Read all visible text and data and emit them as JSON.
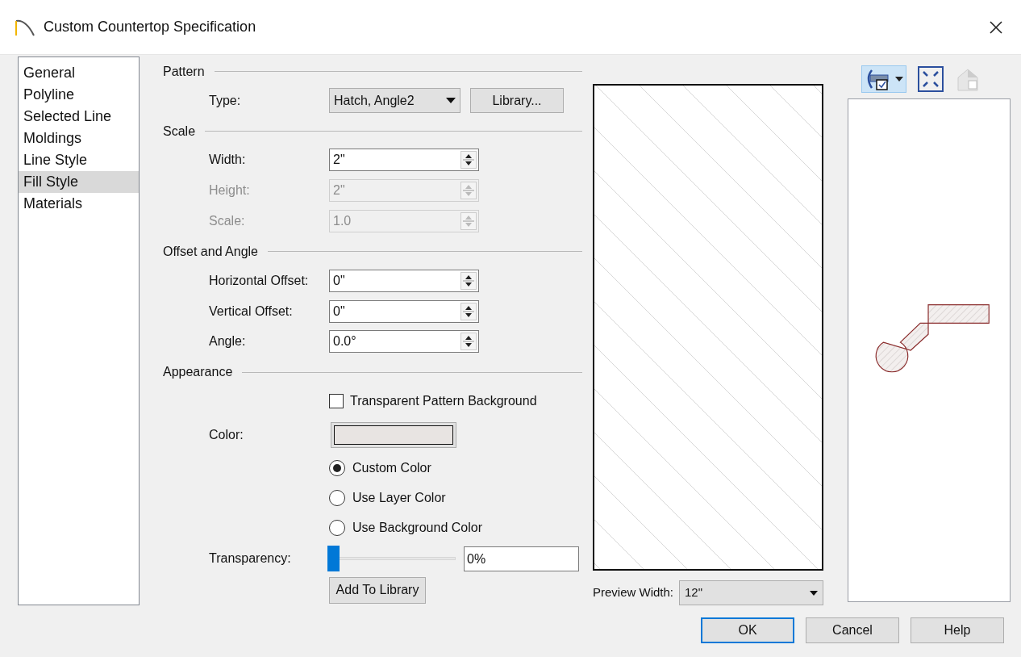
{
  "window": {
    "title": "Custom Countertop Specification"
  },
  "sidebar": {
    "items": [
      {
        "label": "General",
        "selected": false
      },
      {
        "label": "Polyline",
        "selected": false
      },
      {
        "label": "Selected Line",
        "selected": false
      },
      {
        "label": "Moldings",
        "selected": false
      },
      {
        "label": "Line Style",
        "selected": false
      },
      {
        "label": "Fill Style",
        "selected": true
      },
      {
        "label": "Materials",
        "selected": false
      }
    ]
  },
  "sections": [
    {
      "title": "Pattern",
      "rows": [
        {
          "kind": "dropdown",
          "label": "Type:",
          "value": "Hatch, Angle2",
          "button": "Library..."
        }
      ]
    },
    {
      "title": "Scale",
      "rows": [
        {
          "kind": "spin",
          "label": "Width:",
          "value": "2\"",
          "disabled": false
        },
        {
          "kind": "spin",
          "label": "Height:",
          "value": "2\"",
          "disabled": true
        },
        {
          "kind": "spin",
          "label": "Scale:",
          "value": "1.0",
          "disabled": true
        }
      ]
    },
    {
      "title": "Offset and Angle",
      "rows": [
        {
          "kind": "spin",
          "label": "Horizontal Offset:",
          "value": "0\"",
          "disabled": false
        },
        {
          "kind": "spin",
          "label": "Vertical Offset:",
          "value": "0\"",
          "disabled": false
        },
        {
          "kind": "spin",
          "label": "Angle:",
          "value": "0.0°",
          "disabled": false
        }
      ]
    },
    {
      "title": "Appearance",
      "rows": [
        {
          "kind": "checkbox",
          "label": "Transparent Pattern Background",
          "checked": false
        },
        {
          "kind": "color",
          "label": "Color:",
          "color": "#e8e4e2"
        },
        {
          "kind": "radio",
          "label": "Custom Color",
          "selected": true
        },
        {
          "kind": "radio",
          "label": "Use Layer Color",
          "selected": false
        },
        {
          "kind": "radio",
          "label": "Use Background Color",
          "selected": false
        },
        {
          "kind": "slider",
          "label": "Transparency:",
          "level": 0,
          "reading": "0%"
        },
        {
          "kind": "button",
          "label": "Add To Library"
        }
      ]
    }
  ],
  "preview": {
    "width_label": "Preview Width:",
    "width_value": "12\""
  },
  "buttons": [
    {
      "label": "OK",
      "default": true
    },
    {
      "label": "Cancel",
      "default": false
    },
    {
      "label": "Help",
      "default": false
    }
  ]
}
